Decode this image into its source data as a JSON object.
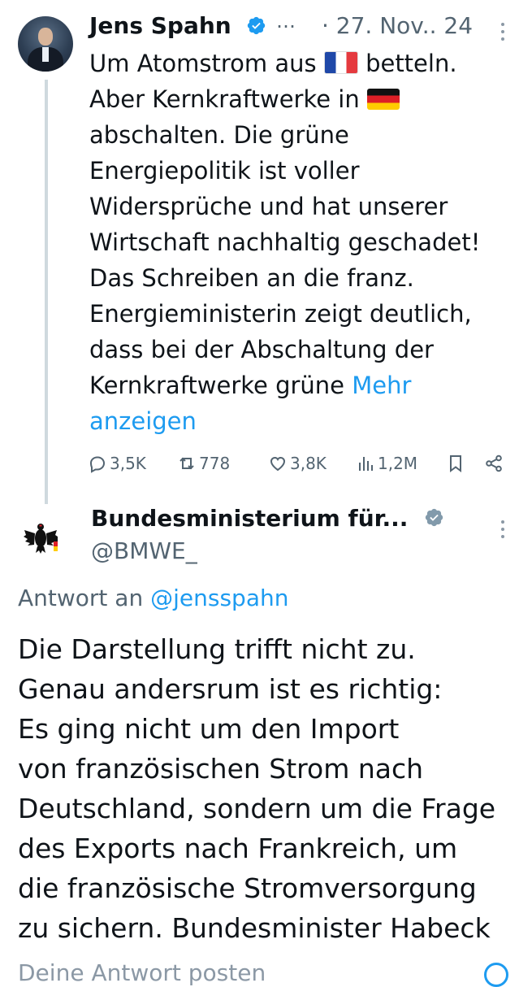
{
  "tweet1": {
    "author_name": "Jens Spahn",
    "truncation": "…",
    "timestamp": "· 27. Nov.. 24",
    "body_lines": [
      "Um Atomstrom aus",
      "betteln.",
      "Aber Kernkraftwerke in",
      "abschalten. Die grüne",
      "Energiepolitik ist voller",
      "Widersprüche und hat unserer",
      "Wirtschaft nachhaltig geschadet!",
      "Das Schreiben an die franz.",
      "Energieministerin zeigt deutlich,",
      "dass bei der Abschaltung der",
      "Kernkraftwerke grüne"
    ],
    "show_more_part1": "Mehr",
    "show_more_part2": "anzeigen",
    "metrics": {
      "replies": "3,5K",
      "reposts": "778",
      "likes": "3,8K",
      "views": "1,2M"
    }
  },
  "tweet2": {
    "author_name": "Bundesministerium für...",
    "handle": "@BMWE_",
    "reply_to_prefix": "Antwort an",
    "reply_to_handle": "@jensspahn",
    "body_lines": [
      "Die Darstellung trifft nicht zu.",
      "Genau andersrum ist es richtig:",
      "Es ging nicht um den Import",
      "von französischen Strom nach",
      "Deutschland, sondern um die Frage",
      "des Exports nach Frankreich, um",
      "die französische Stromversorgung",
      "zu sichern. Bundesminister Habeck"
    ]
  },
  "composer": {
    "placeholder": "Deine Antwort posten"
  },
  "colors": {
    "accent": "#1d9bf0",
    "muted": "#536471",
    "text": "#0f1419",
    "thread_line": "#cfd9de"
  }
}
